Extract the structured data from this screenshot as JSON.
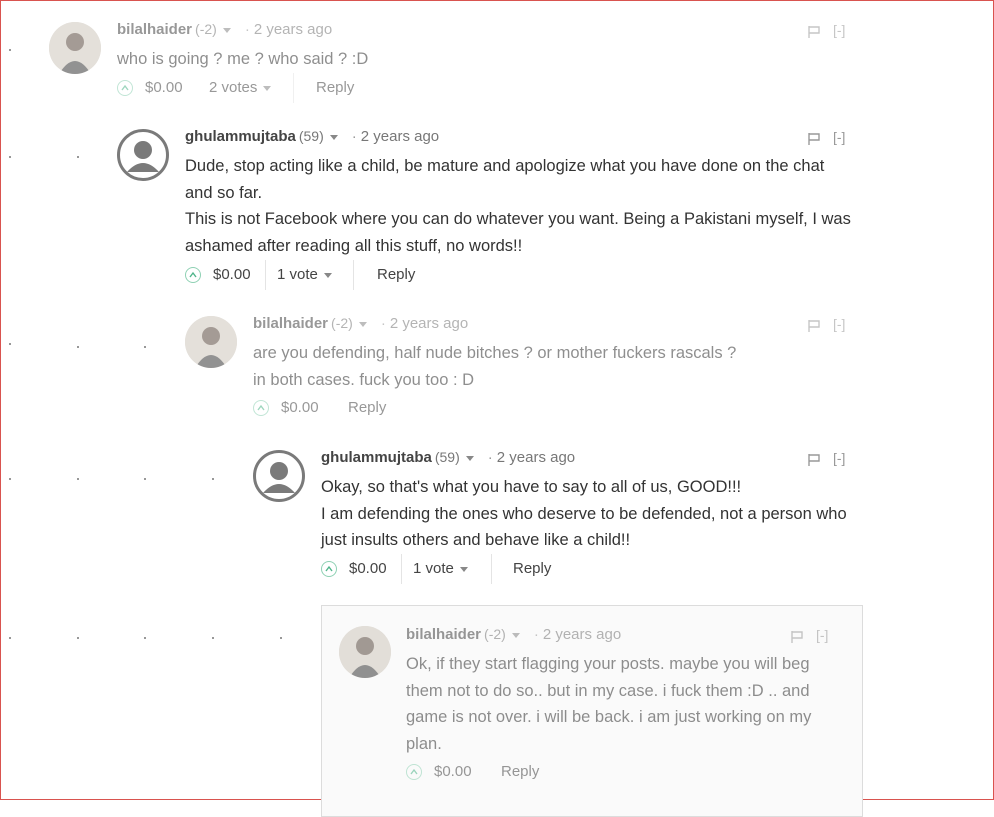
{
  "comments": [
    {
      "author": "bilalhaider",
      "rep": "(-2)",
      "time": "2 years ago",
      "avatar": "user-photo",
      "lines": [
        "who is going ? me ? who said ? :D"
      ],
      "payout": "$0.00",
      "votes": "2 votes",
      "reply": "Reply",
      "collapse": "[-]"
    },
    {
      "author": "ghulammujtaba",
      "rep": "(59)",
      "time": "2 years ago",
      "avatar": "default-user",
      "lines": [
        "Dude, stop acting like a child, be mature and apologize what you have done on the chat",
        "and so far.",
        "This is not Facebook where you can do whatever you want. Being a Pakistani myself, I was",
        "ashamed after reading all this stuff, no words!!"
      ],
      "payout": "$0.00",
      "votes": "1 vote",
      "reply": "Reply",
      "collapse": "[-]"
    },
    {
      "author": "bilalhaider",
      "rep": "(-2)",
      "time": "2 years ago",
      "avatar": "user-photo",
      "lines": [
        "are you defending, half nude bitches ? or mother fuckers rascals ?",
        "in both cases. fuck you too : D"
      ],
      "payout": "$0.00",
      "votes": "",
      "reply": "Reply",
      "collapse": "[-]"
    },
    {
      "author": "ghulammujtaba",
      "rep": "(59)",
      "time": "2 years ago",
      "avatar": "default-user",
      "lines": [
        "Okay, so that's what you have to say to all of us, GOOD!!!",
        "I am defending the ones who deserve to be defended, not a person who",
        "just insults others and behave like a child!!"
      ],
      "payout": "$0.00",
      "votes": "1 vote",
      "reply": "Reply",
      "collapse": "[-]"
    },
    {
      "author": "bilalhaider",
      "rep": "(-2)",
      "time": "2 years ago",
      "avatar": "user-photo",
      "lines": [
        "Ok, if they start flagging your posts. maybe you will beg",
        "them not to do so.. but in my case. i fuck them :D .. and",
        "game is not over. i will be back. i am just working on my",
        "plan."
      ],
      "payout": "$0.00",
      "votes": "",
      "reply": "Reply",
      "collapse": "[-]"
    }
  ],
  "colors": {
    "upvote_border": "#8fd1b4",
    "upvote_arrow": "#4fb58a",
    "text": "#333333",
    "muted": "#777777"
  }
}
